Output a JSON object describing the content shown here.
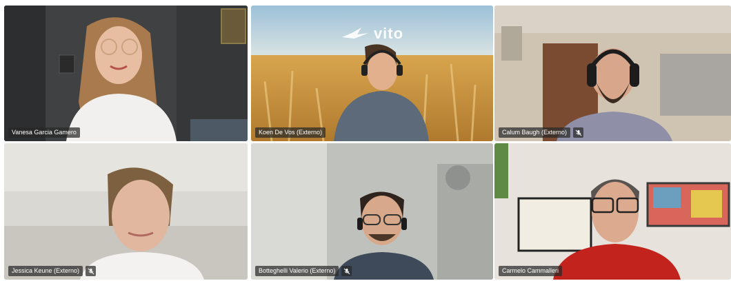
{
  "meeting": {
    "participants": [
      {
        "name": "Vanesa Garcia Gamero",
        "muted": false
      },
      {
        "name": "Koen De Vos (Externo)",
        "muted": false
      },
      {
        "name": "Calum Baugh (Externo)",
        "muted": true
      },
      {
        "name": "Jessica Keune (Externo)",
        "muted": true
      },
      {
        "name": "Botteghelli Valerio (Externo)",
        "muted": true
      },
      {
        "name": "Carmelo Cammalleri",
        "muted": false
      }
    ],
    "background_logo": "vito"
  },
  "colors": {
    "name_tag_bg": "#282828",
    "name_tag_text": "#ffffff"
  },
  "icons": [
    "muted-microphone-icon",
    "vito-bird-logo"
  ]
}
